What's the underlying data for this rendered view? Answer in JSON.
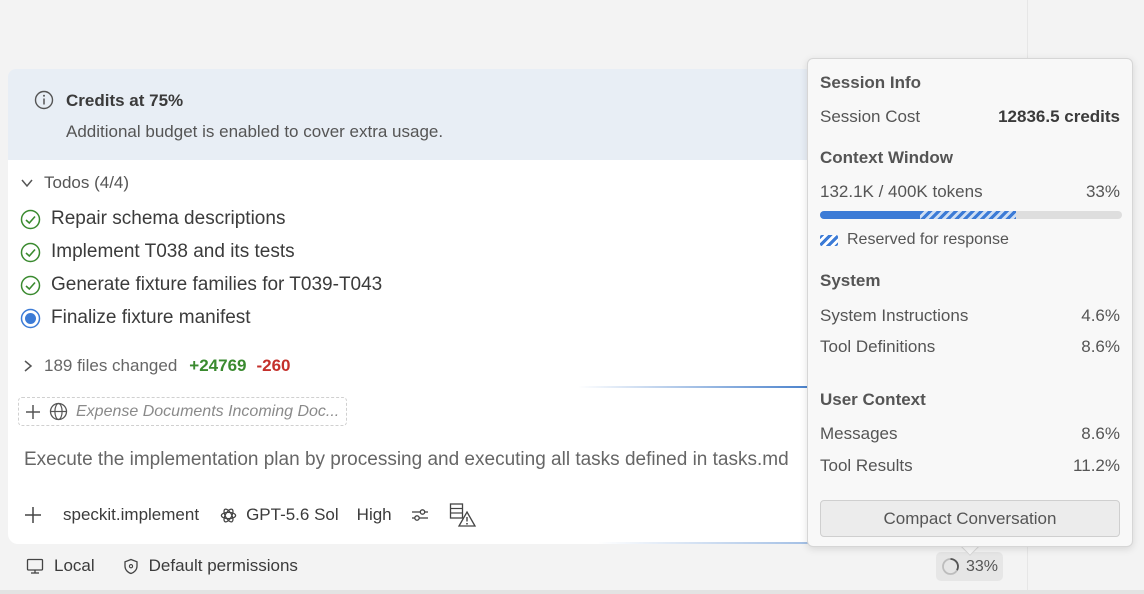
{
  "banner": {
    "title": "Credits at 75%",
    "subtitle": "Additional budget is enabled to cover extra usage.",
    "icon": "info-icon"
  },
  "todos": {
    "header": "Todos (4/4)",
    "items": [
      {
        "label": "Repair schema descriptions",
        "status": "done"
      },
      {
        "label": "Implement T038 and its tests",
        "status": "done"
      },
      {
        "label": "Generate fixture families for T039-T043",
        "status": "done"
      },
      {
        "label": "Finalize fixture manifest",
        "status": "in-progress"
      }
    ]
  },
  "files": {
    "label": "189 files changed",
    "added": "+24769",
    "removed": "-260"
  },
  "attachment": {
    "text": "Expense Documents Incoming Doc..."
  },
  "prompt": {
    "text": "Execute the implementation plan by processing and executing all tasks defined in tasks.md"
  },
  "toolbar": {
    "command": "speckit.implement",
    "model": "GPT-5.6 Sol",
    "effort": "High"
  },
  "status": {
    "location": "Local",
    "permissions": "Default permissions",
    "context_percent": "33%",
    "context_fraction": 0.33
  },
  "popup": {
    "session_info_title": "Session Info",
    "session_cost_label": "Session Cost",
    "session_cost_value": "12836.5 credits",
    "context_window_title": "Context Window",
    "tokens_label": "132.1K / 400K tokens",
    "tokens_percent": "33%",
    "used_fraction": 0.33,
    "reserved_fraction": 0.32,
    "reserved_label": "Reserved for response",
    "system_title": "System",
    "system_instructions_label": "System Instructions",
    "system_instructions_value": "4.6%",
    "tool_definitions_label": "Tool Definitions",
    "tool_definitions_value": "8.6%",
    "user_context_title": "User Context",
    "messages_label": "Messages",
    "messages_value": "8.6%",
    "tool_results_label": "Tool Results",
    "tool_results_value": "11.2%",
    "compact_button": "Compact Conversation"
  },
  "colors": {
    "accent": "#3c7bd6",
    "success": "#3a8a2f",
    "danger": "#c4302b",
    "banner_bg": "#e8eef5"
  }
}
